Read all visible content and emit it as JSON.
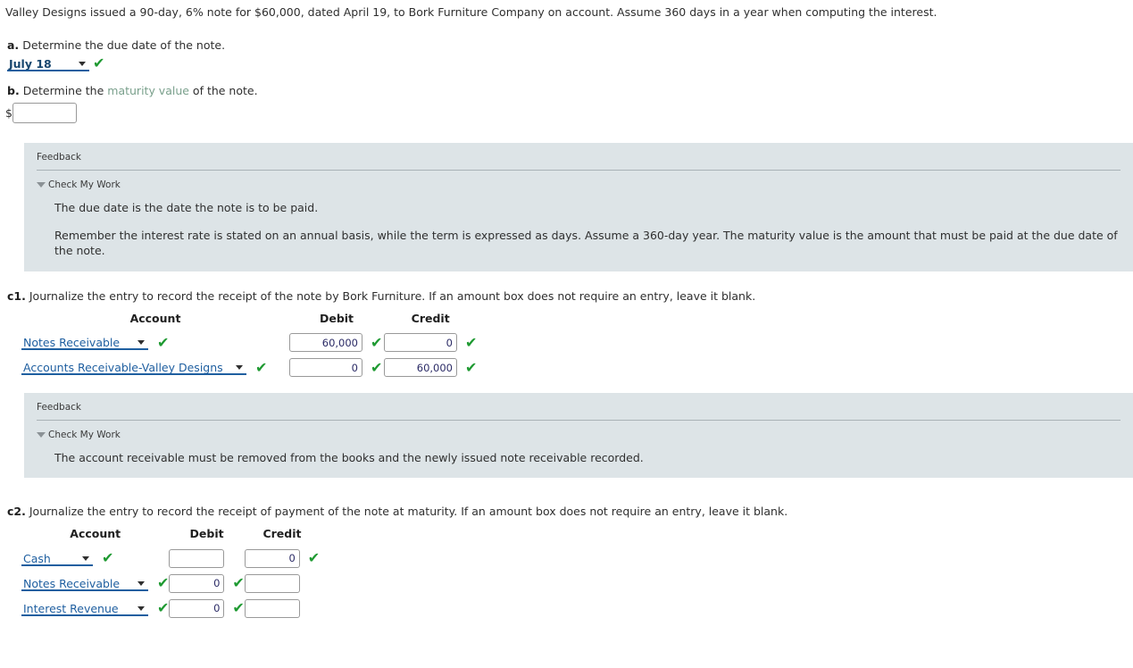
{
  "problem": {
    "statement": "Valley Designs issued a 90-day, 6% note for $60,000, dated April 19, to Bork Furniture Company on account. Assume 360 days in a year when computing the interest."
  },
  "part_a": {
    "label": "a.",
    "text": "Determine the due date of the note.",
    "due_date_select": {
      "value": "July 18",
      "name": "due-date-select"
    },
    "check": "✔"
  },
  "part_b": {
    "label": "b.",
    "text_before": "Determine the ",
    "link_text": "maturity value",
    "text_after": " of the note.",
    "currency_symbol": "$",
    "maturity_value": "",
    "placeholder": ""
  },
  "feedback_b": {
    "title": "Feedback",
    "check_my_work": "Check My Work",
    "lines": [
      "The due date is the date the note is to be paid.",
      "Remember the interest rate is stated on an annual basis, while the term is expressed as days. Assume a 360-day year. The maturity value is the amount that must be paid at the due date of the note."
    ]
  },
  "part_c1": {
    "label": "c1.",
    "text": "Journalize the entry to record the receipt of the note by Bork Furniture. If an amount box does not require an entry, leave it blank.",
    "headers": {
      "account": "Account",
      "debit": "Debit",
      "credit": "Credit"
    },
    "rows": [
      {
        "account": "Notes Receivable",
        "account_check": "✔",
        "debit": "60,000",
        "debit_check": "✔",
        "credit": "0",
        "credit_check": "✔",
        "indent": 0
      },
      {
        "account": "Accounts Receivable-Valley Designs",
        "account_check": "✔",
        "debit": "0",
        "debit_check": "✔",
        "credit": "60,000",
        "credit_check": "✔",
        "indent": 1
      }
    ]
  },
  "feedback_c1": {
    "title": "Feedback",
    "check_my_work": "Check My Work",
    "lines": [
      "The account receivable must be removed from the books and the newly issued note receivable recorded."
    ]
  },
  "part_c2": {
    "label": "c2.",
    "text": "Journalize the entry to record the receipt of payment of the note at maturity. If an amount box does not require an entry, leave it blank.",
    "headers": {
      "account": "Account",
      "debit": "Debit",
      "credit": "Credit"
    },
    "rows": [
      {
        "account": "Cash",
        "account_check": "✔",
        "debit": "",
        "debit_check": "",
        "credit": "0",
        "credit_check": "✔"
      },
      {
        "account": "Notes Receivable",
        "account_check": "✔",
        "debit": "0",
        "debit_check": "✔",
        "credit": "",
        "credit_check": ""
      },
      {
        "account": "Interest Revenue",
        "account_check": "✔",
        "debit": "0",
        "debit_check": "✔",
        "credit": "",
        "credit_check": ""
      }
    ]
  },
  "colors": {
    "feedback_background": "#dde4e7",
    "select_blue": "#1f5fa0",
    "check_green": "#1f9a32",
    "term_link_green": "#7aa08c",
    "text": "#2f2f2f"
  }
}
